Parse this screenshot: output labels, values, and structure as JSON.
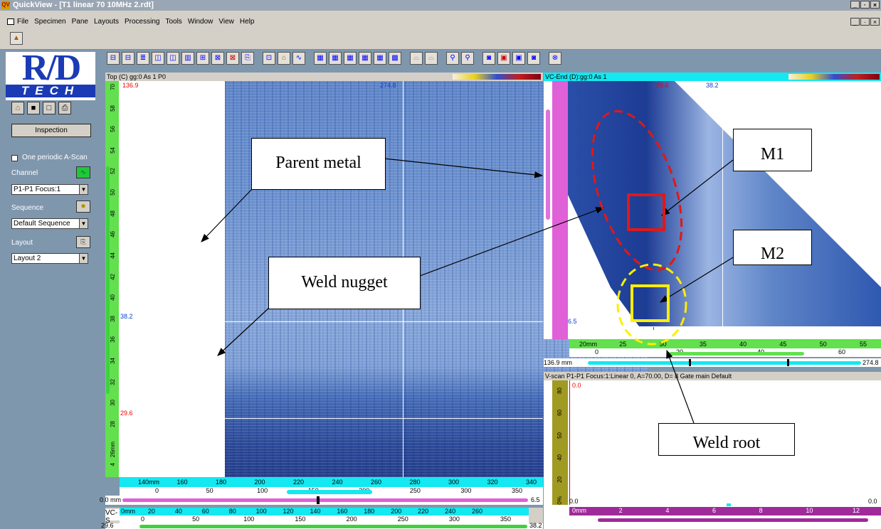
{
  "window": {
    "title": "QuickView - [T1 linear 70 10MHz 2.rdt]",
    "app_icon": "QV",
    "controls": [
      "_",
      "·",
      "×"
    ]
  },
  "menu": [
    "File",
    "Specimen",
    "Pane",
    "Layouts",
    "Processing",
    "Tools",
    "Window",
    "View",
    "Help"
  ],
  "left_panel": {
    "logo_main": "R/D",
    "logo_sub": "TECH",
    "inspection_button": "Inspection",
    "one_periodic_ascan": "One periodic A-Scan",
    "channel_label": "Channel",
    "channel_value": "P1-P1 Focus:1",
    "sequence_label": "Sequence",
    "sequence_value": "Default Sequence",
    "layout_label": "Layout",
    "layout_value": "Layout 2"
  },
  "top_view": {
    "header": "Top (C) gg:0 As 1 P0",
    "cursor_left": "136.9",
    "cursor_right": "274.8",
    "cursor_mid": "38.2",
    "cursor_low": "29.6",
    "scale_ticks": [
      "140mm",
      "160",
      "180",
      "200",
      "220",
      "240",
      "260",
      "280",
      "300",
      "320",
      "340"
    ],
    "scale2_ticks": [
      "0",
      "50",
      "100",
      "150",
      "200",
      "250",
      "300",
      "350"
    ],
    "scrollbar_value": "0.0 mm",
    "scrollbar_end": "6.5",
    "vruler_ticks": [
      "70",
      "58",
      "56",
      "54",
      "52",
      "50",
      "48",
      "46",
      "44",
      "42",
      "40",
      "38",
      "36",
      "34",
      "32",
      "30",
      "28",
      "26mm",
      "4"
    ]
  },
  "end_view": {
    "header": "VC-End (D):gg:0 As 1",
    "cursor_a": "29.6",
    "cursor_b": "38.2",
    "corner": "0.0",
    "cursor_depth": "6.5",
    "scale_ticks": [
      "20mm",
      "25",
      "30",
      "35",
      "40",
      "45",
      "50",
      "55"
    ],
    "scale2_ticks": [
      "0",
      "20",
      "40",
      "60"
    ],
    "scroll_left": "136.9 mm",
    "scroll_right": "274.8"
  },
  "vscan": {
    "header": "V-scan P1-P1 Focus:1:Linear 0, A=70.00, D=  8 Gate main Default",
    "top_value": "0.0",
    "corner_left": "0.0",
    "corner_right": "0.0",
    "axis_left": "0%",
    "vticks": [
      "80",
      "60",
      "50",
      "40",
      "20"
    ],
    "scale_ticks": [
      "0mm",
      "2",
      "4",
      "6",
      "8",
      "10",
      "12"
    ]
  },
  "bottom_pane": {
    "header": "VC-S",
    "scale_ticks": [
      "0mm",
      "20",
      "40",
      "60",
      "80",
      "100",
      "120",
      "140",
      "160",
      "180",
      "200",
      "220",
      "240",
      "260"
    ],
    "scale2_ticks": [
      "0",
      "50",
      "100",
      "150",
      "200",
      "250",
      "300",
      "350"
    ],
    "value": "29.6",
    "end_value": "38.2"
  },
  "annotations": {
    "parent_metal": "Parent metal",
    "weld_nugget": "Weld nugget",
    "m1": "M1",
    "m2": "M2",
    "weld_root": "Weld root"
  },
  "colors": {
    "accent_red": "#e01818",
    "accent_yellow": "#ffee00",
    "ruler_green": "#62e04e",
    "ruler_cyan": "#14e8f0",
    "ruler_magenta": "#a02a9a"
  }
}
